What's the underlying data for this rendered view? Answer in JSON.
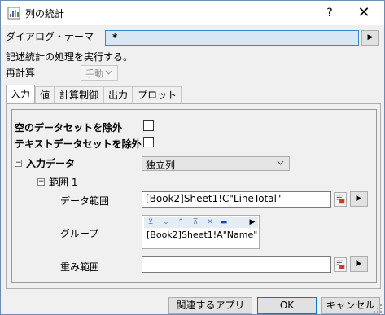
{
  "window": {
    "title": "列の統計",
    "help_label": "?",
    "close_label": "✕"
  },
  "theme": {
    "label": "ダイアログ・テーマ",
    "value": "*"
  },
  "description": "記述統計の処理を実行する。",
  "recalc": {
    "label": "再計算",
    "value": "手動"
  },
  "tabs": [
    {
      "label": "入力",
      "active": true
    },
    {
      "label": "値"
    },
    {
      "label": "計算制御"
    },
    {
      "label": "出力"
    },
    {
      "label": "プロット"
    }
  ],
  "input": {
    "exclude_empty_label": "空のデータセットを除外",
    "exclude_text_label": "テキストデータセットを除外",
    "input_data_label": "入力データ",
    "input_data_value": "独立列",
    "range_label": "範囲 1",
    "data_range_label": "データ範囲",
    "data_range_value": "[Book2]Sheet1!C\"LineTotal\"",
    "group_label": "グループ",
    "group_value": "[Book2]Sheet1!A\"Name\"",
    "weight_range_label": "重み範囲",
    "weight_range_value": ""
  },
  "buttons": {
    "related_apps": "関連するアプリ",
    "ok": "OK",
    "cancel": "キャンセル"
  },
  "colors": {
    "accent": "#0078d7",
    "focus_field_bg": "#d9e6f4",
    "toolbar_icon": "#5a7bb0"
  }
}
